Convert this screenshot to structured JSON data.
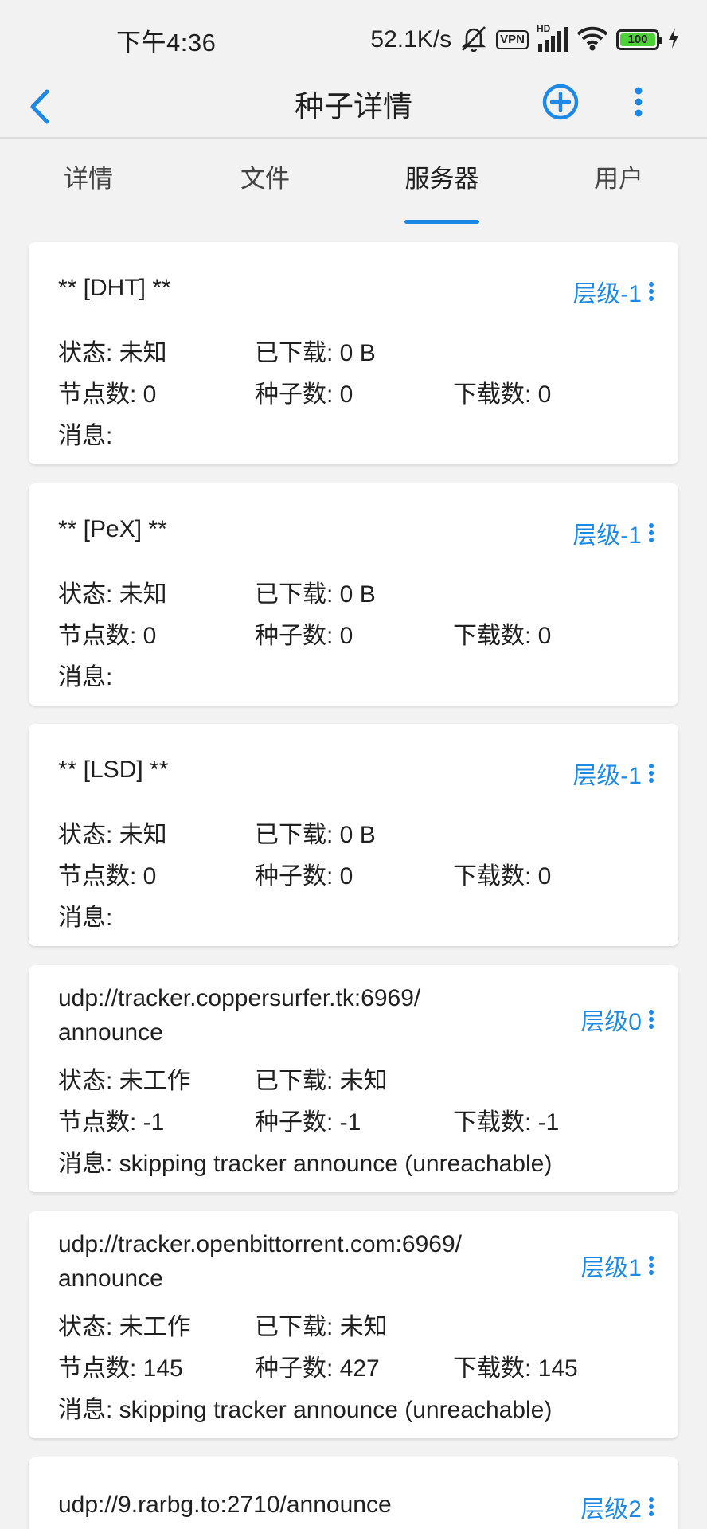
{
  "status_bar": {
    "time": "下午4:36",
    "net_speed": "52.1K/s",
    "vpn_label": "VPN",
    "hd_label": "HD",
    "battery_level": "100"
  },
  "appbar": {
    "title": "种子详情"
  },
  "tabs": [
    {
      "label": "详情",
      "active": false
    },
    {
      "label": "文件",
      "active": false
    },
    {
      "label": "服务器",
      "active": true
    },
    {
      "label": "用户",
      "active": false
    }
  ],
  "trackers": [
    {
      "url": "** [DHT] **",
      "tier": "层级-1",
      "status": "状态: 未知",
      "downloaded": "已下载: 0 B",
      "peers": "节点数: 0",
      "seeds": "种子数: 0",
      "leechers": "下载数: 0",
      "message": "消息:"
    },
    {
      "url": "** [PeX] **",
      "tier": "层级-1",
      "status": "状态: 未知",
      "downloaded": "已下载: 0 B",
      "peers": "节点数: 0",
      "seeds": "种子数: 0",
      "leechers": "下载数: 0",
      "message": "消息:"
    },
    {
      "url": "** [LSD] **",
      "tier": "层级-1",
      "status": "状态: 未知",
      "downloaded": "已下载: 0 B",
      "peers": "节点数: 0",
      "seeds": "种子数: 0",
      "leechers": "下载数: 0",
      "message": "消息:"
    },
    {
      "url": "udp://tracker.coppersurfer.tk:6969/\nannounce",
      "url_line1": "udp://tracker.coppersurfer.tk:6969/",
      "url_line2": "announce",
      "tier": "层级0",
      "status": "状态: 未工作",
      "downloaded": "已下载: 未知",
      "peers": "节点数: -1",
      "seeds": "种子数: -1",
      "leechers": "下载数: -1",
      "message": "消息: skipping tracker announce (unreachable)"
    },
    {
      "url_line1": "udp://tracker.openbittorrent.com:6969/",
      "url_line2": "announce",
      "tier": "层级1",
      "status": "状态: 未工作",
      "downloaded": "已下载: 未知",
      "peers": "节点数: 145",
      "seeds": "种子数: 427",
      "leechers": "下载数: 145",
      "message": "消息: skipping tracker announce (unreachable)"
    },
    {
      "url": "udp://9.rarbg.to:2710/announce",
      "tier": "层级2"
    }
  ],
  "colors": {
    "accent": "#1e88e5",
    "background": "#f2f2f2",
    "card": "#ffffff"
  }
}
